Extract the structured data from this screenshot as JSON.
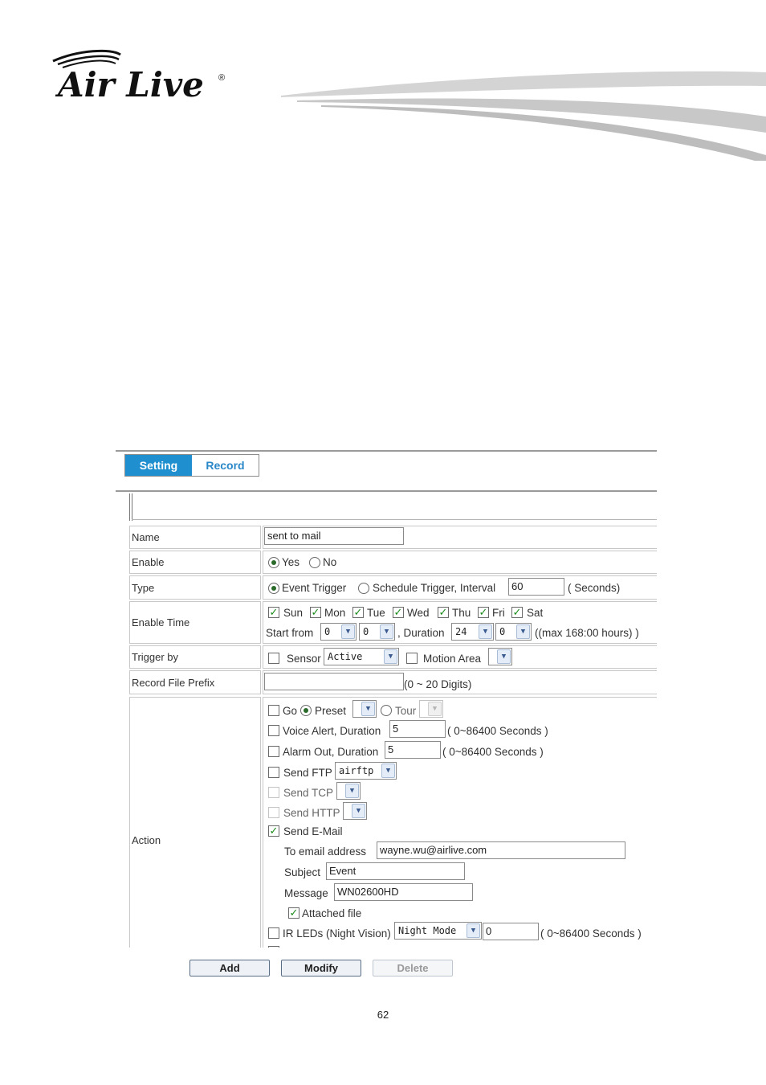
{
  "brand": {
    "logo_text": "Air Live",
    "registered": "®"
  },
  "tabs": {
    "setting": "Setting",
    "record": "Record"
  },
  "rows": {
    "name": {
      "label": "Name",
      "value": "sent to mail"
    },
    "enable": {
      "label": "Enable",
      "yes": "Yes",
      "no": "No",
      "selected": "Yes"
    },
    "type": {
      "label": "Type",
      "event": "Event Trigger",
      "schedule": "Schedule Trigger, Interval",
      "interval": "60",
      "unit": "( Seconds)",
      "selected": "Event Trigger"
    },
    "enable_time": {
      "label": "Enable Time",
      "days": [
        "Sun",
        "Mon",
        "Tue",
        "Wed",
        "Thu",
        "Fri",
        "Sat"
      ],
      "start_from": "Start from",
      "start_hour": "0",
      "start_min": "0",
      "duration_label": ", Duration",
      "duration_hour": "24",
      "duration_min": "0",
      "max_note": "((max 168:00 hours) )"
    },
    "trigger_by": {
      "label": "Trigger by",
      "sensor": "Sensor",
      "sensor_value": "Active",
      "motion": "Motion Area"
    },
    "record_prefix": {
      "label": "Record File Prefix",
      "value": "",
      "note": "(0 ~ 20 Digits)"
    },
    "action": {
      "label": "Action",
      "go": "Go",
      "preset": "Preset",
      "tour": "Tour",
      "voice_alert": "Voice Alert, Duration",
      "voice_value": "5",
      "voice_note": "( 0~86400 Seconds )",
      "alarm_out": "Alarm Out, Duration",
      "alarm_value": "5",
      "alarm_note": "( 0~86400 Seconds )",
      "send_ftp": "Send FTP",
      "ftp_value": "airftp",
      "send_tcp": "Send TCP",
      "send_http": "Send HTTP",
      "send_email": "Send E-Mail",
      "to_email_label": "To email address",
      "to_email_value": "wayne.wu@airlive.com",
      "subject_label": "Subject",
      "subject_value": "Event",
      "message_label": "Message",
      "message_value": "WN02600HD",
      "attached": "Attached file",
      "ir_leds": "IR LEDs (Night Vision)",
      "ir_mode": "Night Mode",
      "ir_value": "0",
      "ir_note": "( 0~86400 Seconds )"
    }
  },
  "buttons": {
    "add": "Add",
    "modify": "Modify",
    "delete": "Delete"
  },
  "footer": {
    "page_number": "62"
  }
}
